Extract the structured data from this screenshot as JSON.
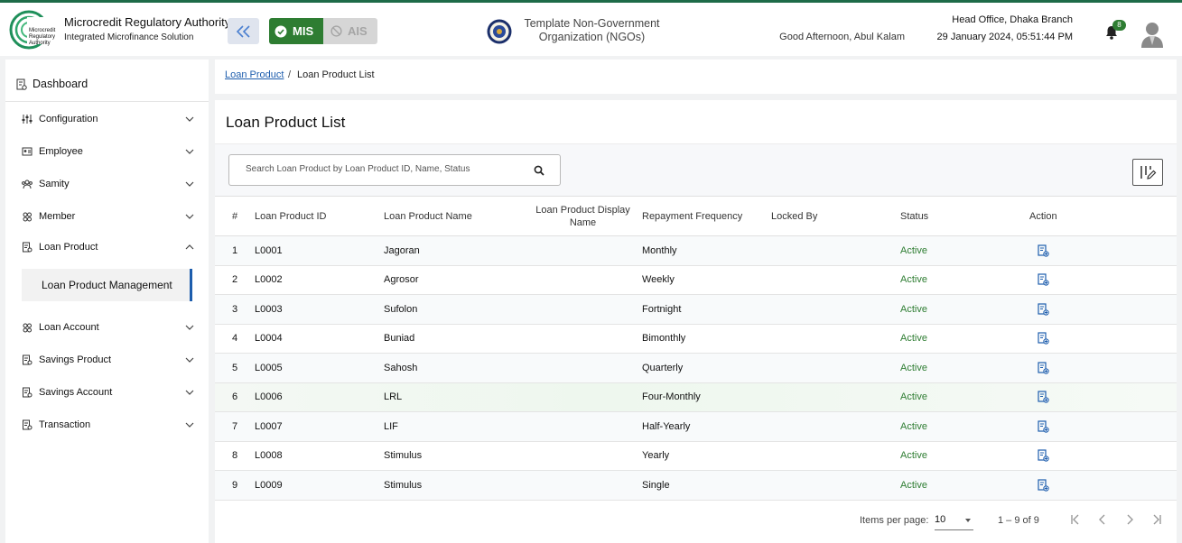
{
  "header": {
    "brand_title": "Microcredit Regulatory Authority",
    "brand_subtitle": "Integrated Microfinance Solution",
    "logo_text": [
      "Microcredit",
      "Regulatory",
      "Authority"
    ],
    "mis_label": "MIS",
    "ais_label": "AIS",
    "org_name": "Template Non-Government Organization (NGOs)",
    "greeting": "Good Afternoon, Abul Kalam",
    "branch": "Head Office, Dhaka Branch",
    "datetime": "29 January 2024, 05:51:44 PM",
    "notification_count": "8",
    "accent_color": "#2e7d32"
  },
  "sidebar": {
    "dashboard_label": "Dashboard",
    "items": [
      {
        "label": "Configuration",
        "icon": "sliders-icon"
      },
      {
        "label": "Employee",
        "icon": "id-card-icon"
      },
      {
        "label": "Samity",
        "icon": "group-icon"
      },
      {
        "label": "Member",
        "icon": "members-icon"
      },
      {
        "label": "Loan Product",
        "icon": "document-icon"
      },
      {
        "label": "Loan Account",
        "icon": "members-icon"
      },
      {
        "label": "Savings Product",
        "icon": "document-icon"
      },
      {
        "label": "Savings Account",
        "icon": "document-icon"
      },
      {
        "label": "Transaction",
        "icon": "document-icon"
      }
    ],
    "sub_item": "Loan Product Management"
  },
  "breadcrumb": {
    "link": "Loan Product",
    "separator": "/",
    "current": "Loan Product List"
  },
  "main": {
    "title": "Loan Product List",
    "search_placeholder": "Search Loan Product by Loan Product ID, Name, Status",
    "columns": [
      "#",
      "Loan Product ID",
      "Loan Product Name",
      "Loan Product Display Name",
      "Repayment Frequency",
      "Locked By",
      "Status",
      "Action"
    ],
    "rows": [
      {
        "n": "1",
        "id": "L0001",
        "name": "Jagoran",
        "display": "",
        "freq": "Monthly",
        "locked": "",
        "status": "Active"
      },
      {
        "n": "2",
        "id": "L0002",
        "name": "Agrosor",
        "display": "",
        "freq": "Weekly",
        "locked": "",
        "status": "Active"
      },
      {
        "n": "3",
        "id": "L0003",
        "name": "Sufolon",
        "display": "",
        "freq": "Fortnight",
        "locked": "",
        "status": "Active"
      },
      {
        "n": "4",
        "id": "L0004",
        "name": "Buniad",
        "display": "",
        "freq": "Bimonthly",
        "locked": "",
        "status": "Active"
      },
      {
        "n": "5",
        "id": "L0005",
        "name": "Sahosh",
        "display": "",
        "freq": "Quarterly",
        "locked": "",
        "status": "Active"
      },
      {
        "n": "6",
        "id": "L0006",
        "name": "LRL",
        "display": "",
        "freq": "Four-Monthly",
        "locked": "",
        "status": "Active"
      },
      {
        "n": "7",
        "id": "L0007",
        "name": "LIF",
        "display": "",
        "freq": "Half-Yearly",
        "locked": "",
        "status": "Active"
      },
      {
        "n": "8",
        "id": "L0008",
        "name": "Stimulus",
        "display": "",
        "freq": "Yearly",
        "locked": "",
        "status": "Active"
      },
      {
        "n": "9",
        "id": "L0009",
        "name": "Stimulus",
        "display": "",
        "freq": "Single",
        "locked": "",
        "status": "Active"
      }
    ],
    "status_color": "#2e7d32"
  },
  "pagination": {
    "items_per_page_label": "Items per page:",
    "items_per_page": "10",
    "range": "1 – 9 of 9"
  }
}
